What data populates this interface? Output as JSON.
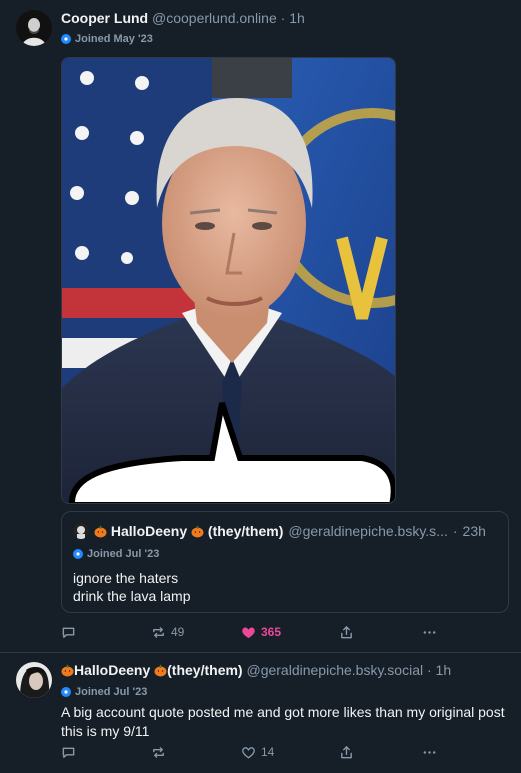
{
  "post1": {
    "display_name": "Cooper Lund",
    "handle": "@cooperlund.online",
    "sep": " · ",
    "time": "1h",
    "joined": "Joined May '23",
    "quote": {
      "name_prefix": "HalloDeeny",
      "name_suffix": "(they/them)",
      "handle": "@geraldinepiche.bsky.s...",
      "sep": " · ",
      "time": "23h",
      "joined": "Joined Jul '23",
      "text_line1": "ignore the haters",
      "text_line2": "drink the lava lamp"
    },
    "actions": {
      "reply_icon": "reply-icon",
      "repost_count": "49",
      "like_count": "365",
      "share_icon": "share-icon",
      "more_icon": "more-icon"
    }
  },
  "post2": {
    "name_prefix": "HalloDeeny",
    "name_suffix": "(they/them)",
    "handle": "@geraldinepiche.bsky.social",
    "sep": " · ",
    "time": "1h",
    "joined": "Joined Jul '23",
    "text": "A big account quote posted me and got more likes than my original post this is my 9/11",
    "actions": {
      "like_count": "14"
    }
  },
  "colors": {
    "background": "#161e27",
    "muted": "#8899aa",
    "accent": "#208bfe",
    "like": "#ec4899",
    "border": "#2e3a48"
  }
}
